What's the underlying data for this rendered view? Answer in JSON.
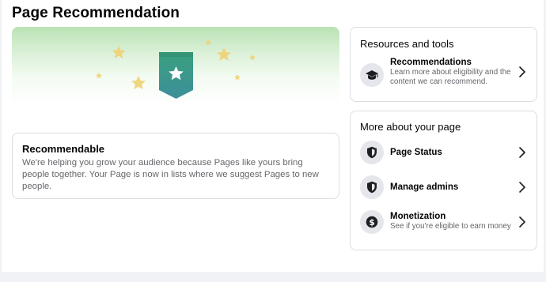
{
  "page": {
    "title": "Page Recommendation",
    "top_fragment": "Pages"
  },
  "status_card": {
    "title": "Recommendable",
    "body": "We're helping you grow your audience because Pages like yours bring people together. Your Page is now in lists where we suggest Pages to new people."
  },
  "resources_panel": {
    "title": "Resources and tools",
    "items": [
      {
        "label": "Recommendations",
        "description": "Learn more about eligibility and the content we can recommend.",
        "icon": "graduation-cap-icon"
      }
    ]
  },
  "more_panel": {
    "title": "More about your page",
    "items": [
      {
        "label": "Page Status",
        "description": "",
        "icon": "shield-icon"
      },
      {
        "label": "Manage admins",
        "description": "",
        "icon": "shield-icon"
      },
      {
        "label": "Monetization",
        "description": "See if you're eligible to earn money",
        "icon": "dollar-coin-icon"
      }
    ]
  },
  "colors": {
    "banner_green": "#b9e2b4",
    "badge_teal": "#3f9c8a",
    "star_gold": "#f2d27a",
    "muted_text": "#65676b",
    "icon_bg": "#e4e6eb"
  }
}
